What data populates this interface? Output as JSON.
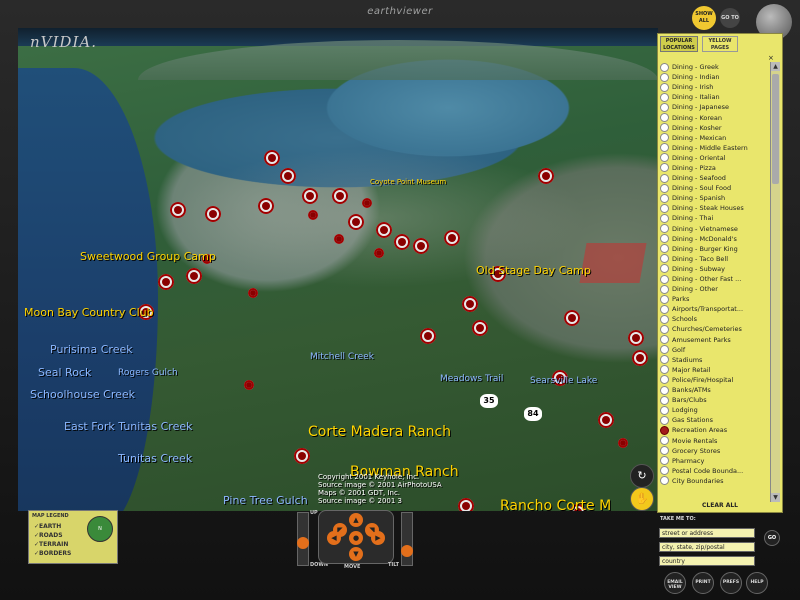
{
  "window": {
    "title": "earthviewer",
    "brand": "nVIDIA."
  },
  "toolbar": {
    "show_all": "SHOW ALL",
    "go_to": "GO TO",
    "keyhole": "keyhole"
  },
  "map": {
    "places_big": [
      "Corte Madera Ranch",
      "Bowman Ranch",
      "Rancho Corte M"
    ],
    "places_yellow": [
      "Sweetwood Group Camp",
      "Moon Bay Country Club",
      "Old Stage Day Camp",
      "Coyote Point Museum"
    ],
    "places_blue": [
      "Purisima Creek",
      "Seal Rock",
      "Schoolhouse Creek",
      "East Fork Tunitas Creek",
      "Tunitas Creek",
      "Pine Tree Gulch",
      "Mitchell Creek",
      "Rogers Gulch",
      "Meadows Trail",
      "Searsville Lake"
    ],
    "routes": [
      "35",
      "84"
    ],
    "copyright": [
      "Copyright 2001 Keyhole, Inc.",
      "Source image © 2001 AirPhotoUSA",
      "Maps © 2001 GDT, Inc.",
      "Source image © 2001 3"
    ]
  },
  "panel": {
    "tab_popular": "POPULAR LOCATIONS",
    "tab_yellow": "YELLOW PAGES",
    "close": "×",
    "clear_all": "CLEAR ALL",
    "items": [
      {
        "label": "Dining - Greek",
        "on": false
      },
      {
        "label": "Dining - Indian",
        "on": false
      },
      {
        "label": "Dining - Irish",
        "on": false
      },
      {
        "label": "Dining - Italian",
        "on": false
      },
      {
        "label": "Dining - Japanese",
        "on": false
      },
      {
        "label": "Dining - Korean",
        "on": false
      },
      {
        "label": "Dining - Kosher",
        "on": false
      },
      {
        "label": "Dining - Mexican",
        "on": false
      },
      {
        "label": "Dining - Middle Eastern",
        "on": false
      },
      {
        "label": "Dining - Oriental",
        "on": false
      },
      {
        "label": "Dining - Pizza",
        "on": false
      },
      {
        "label": "Dining - Seafood",
        "on": false
      },
      {
        "label": "Dining - Soul Food",
        "on": false
      },
      {
        "label": "Dining - Spanish",
        "on": false
      },
      {
        "label": "Dining - Steak Houses",
        "on": false
      },
      {
        "label": "Dining - Thai",
        "on": false
      },
      {
        "label": "Dining - Vietnamese",
        "on": false
      },
      {
        "label": "Dining - McDonald's",
        "on": false
      },
      {
        "label": "Dining - Burger King",
        "on": false
      },
      {
        "label": "Dining - Taco Bell",
        "on": false
      },
      {
        "label": "Dining - Subway",
        "on": false
      },
      {
        "label": "Dining - Other Fast ...",
        "on": false
      },
      {
        "label": "Dining - Other",
        "on": false
      },
      {
        "label": "Parks",
        "on": false
      },
      {
        "label": "Airports/Transportat...",
        "on": false
      },
      {
        "label": "Schools",
        "on": false
      },
      {
        "label": "Churches/Cemeteries",
        "on": false
      },
      {
        "label": "Amusement Parks",
        "on": false
      },
      {
        "label": "Golf",
        "on": false
      },
      {
        "label": "Stadiums",
        "on": false
      },
      {
        "label": "Major Retail",
        "on": false
      },
      {
        "label": "Police/Fire/Hospital",
        "on": false
      },
      {
        "label": "Banks/ATMs",
        "on": false
      },
      {
        "label": "Bars/Clubs",
        "on": false
      },
      {
        "label": "Lodging",
        "on": false
      },
      {
        "label": "Gas Stations",
        "on": false
      },
      {
        "label": "Recreation Areas",
        "on": true
      },
      {
        "label": "Movie Rentals",
        "on": false
      },
      {
        "label": "Grocery Stores",
        "on": false
      },
      {
        "label": "Pharmacy",
        "on": false
      },
      {
        "label": "Postal Code Bounda...",
        "on": false
      },
      {
        "label": "City Boundaries",
        "on": false
      }
    ]
  },
  "legend": {
    "title": "MAP LEGEND",
    "items": [
      "EARTH",
      "ROADS",
      "TERRAIN",
      "BORDERS"
    ],
    "compass": "N"
  },
  "nav": {
    "up": "UP",
    "down": "DOWN",
    "move": "MOVE",
    "tilt": "TILT"
  },
  "take_me": {
    "label": "TAKE ME TO:",
    "street": "street or address",
    "city": "city, state, zip/postal",
    "country": "country",
    "go": "GO"
  },
  "bottom_buttons": [
    "EMAIL VIEW",
    "PRINT",
    "PREFS",
    "HELP"
  ]
}
